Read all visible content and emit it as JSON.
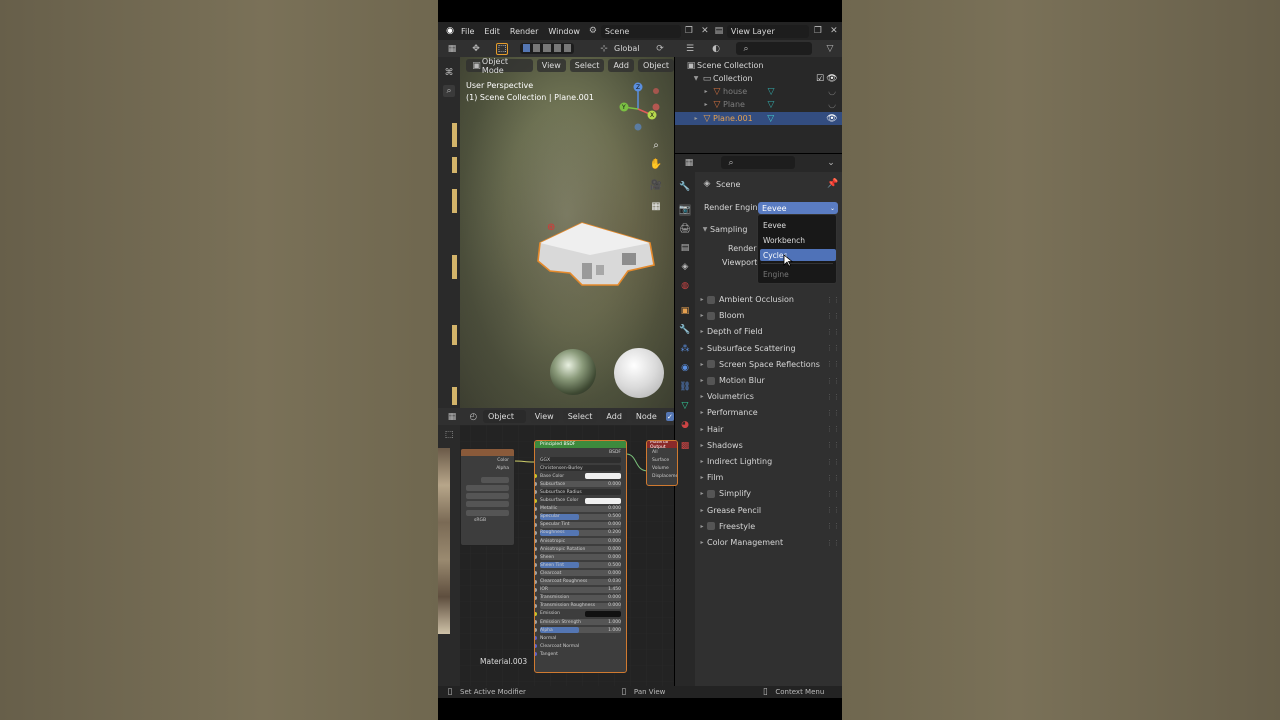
{
  "topbar": {
    "menus": [
      "File",
      "Edit",
      "Render",
      "Window"
    ],
    "scene": "Scene",
    "view_layer": "View Layer"
  },
  "toolbar": {
    "orientation": "Global"
  },
  "viewport": {
    "mode": "Object Mode",
    "menus": [
      "View",
      "Select",
      "Add",
      "Object"
    ],
    "perspective": "User Perspective",
    "collection_info": "(1) Scene Collection | Plane.001",
    "gizmo": {
      "z": "Z",
      "y": "Y",
      "x": "X"
    }
  },
  "outliner": {
    "root": "Scene Collection",
    "collection": "Collection",
    "items": [
      "house",
      "Plane",
      "Plane.001"
    ]
  },
  "properties": {
    "scene": "Scene",
    "render_engine_label": "Render Engine",
    "render_engine_value": "Eevee",
    "sampling": "Sampling",
    "render": "Render",
    "viewport": "Viewport",
    "panels": [
      {
        "label": "Ambient Occlusion",
        "checkbox": true
      },
      {
        "label": "Bloom",
        "checkbox": true
      },
      {
        "label": "Depth of Field",
        "checkbox": false
      },
      {
        "label": "Subsurface Scattering",
        "checkbox": false
      },
      {
        "label": "Screen Space Reflections",
        "checkbox": true
      },
      {
        "label": "Motion Blur",
        "checkbox": true
      },
      {
        "label": "Volumetrics",
        "checkbox": false
      },
      {
        "label": "Performance",
        "checkbox": false
      },
      {
        "label": "Hair",
        "checkbox": false
      },
      {
        "label": "Shadows",
        "checkbox": false
      },
      {
        "label": "Indirect Lighting",
        "checkbox": false
      },
      {
        "label": "Film",
        "checkbox": false
      },
      {
        "label": "Simplify",
        "checkbox": true
      },
      {
        "label": "Grease Pencil",
        "checkbox": false
      },
      {
        "label": "Freestyle",
        "checkbox": true
      },
      {
        "label": "Color Management",
        "checkbox": false
      }
    ],
    "dropdown": {
      "options": [
        "Eevee",
        "Workbench",
        "Cycles"
      ],
      "footer": "Engine",
      "selected": "Cycles"
    }
  },
  "node_editor": {
    "type": "Object",
    "menus": [
      "View",
      "Select",
      "Add",
      "Node"
    ],
    "material": "Material.003",
    "image_node": {
      "outputs": [
        "Color",
        "Alpha"
      ],
      "colorspace": "sRGB"
    },
    "bsdf": {
      "title": "Principled BSDF",
      "output": "BSDF",
      "dist": "GGX",
      "ss_method": "Christensen-Burley",
      "rows": [
        {
          "label": "Base Color",
          "value": "",
          "kind": "color"
        },
        {
          "label": "Subsurface",
          "value": "0.000",
          "kind": "plain"
        },
        {
          "label": "Subsurface Radius",
          "value": "",
          "kind": "menu"
        },
        {
          "label": "Subsurface Color",
          "value": "",
          "kind": "color"
        },
        {
          "label": "Metallic",
          "value": "0.000",
          "kind": "plain"
        },
        {
          "label": "Specular",
          "value": "0.500",
          "kind": "blue"
        },
        {
          "label": "Specular Tint",
          "value": "0.000",
          "kind": "plain"
        },
        {
          "label": "Roughness",
          "value": "0.200",
          "kind": "blue"
        },
        {
          "label": "Anisotropic",
          "value": "0.000",
          "kind": "plain"
        },
        {
          "label": "Anisotropic Rotation",
          "value": "0.000",
          "kind": "plain"
        },
        {
          "label": "Sheen",
          "value": "0.000",
          "kind": "plain"
        },
        {
          "label": "Sheen Tint",
          "value": "0.500",
          "kind": "blue"
        },
        {
          "label": "Clearcoat",
          "value": "0.000",
          "kind": "plain"
        },
        {
          "label": "Clearcoat Roughness",
          "value": "0.030",
          "kind": "plain"
        },
        {
          "label": "IOR",
          "value": "1.450",
          "kind": "plain"
        },
        {
          "label": "Transmission",
          "value": "0.000",
          "kind": "plain"
        },
        {
          "label": "Transmission Roughness",
          "value": "0.000",
          "kind": "plain"
        },
        {
          "label": "Emission",
          "value": "",
          "kind": "dark"
        },
        {
          "label": "Emission Strength",
          "value": "1.000",
          "kind": "plain"
        },
        {
          "label": "Alpha",
          "value": "1.000",
          "kind": "blue"
        },
        {
          "label": "Normal",
          "value": "",
          "kind": "socket"
        },
        {
          "label": "Clearcoat Normal",
          "value": "",
          "kind": "socket"
        },
        {
          "label": "Tangent",
          "value": "",
          "kind": "socket"
        }
      ]
    },
    "output_node": {
      "title": "Material Output",
      "target": "All",
      "inputs": [
        "Surface",
        "Volume",
        "Displacement"
      ]
    }
  },
  "status": {
    "left": "Set Active Modifier",
    "middle": "Pan View",
    "right": "Context Menu"
  }
}
